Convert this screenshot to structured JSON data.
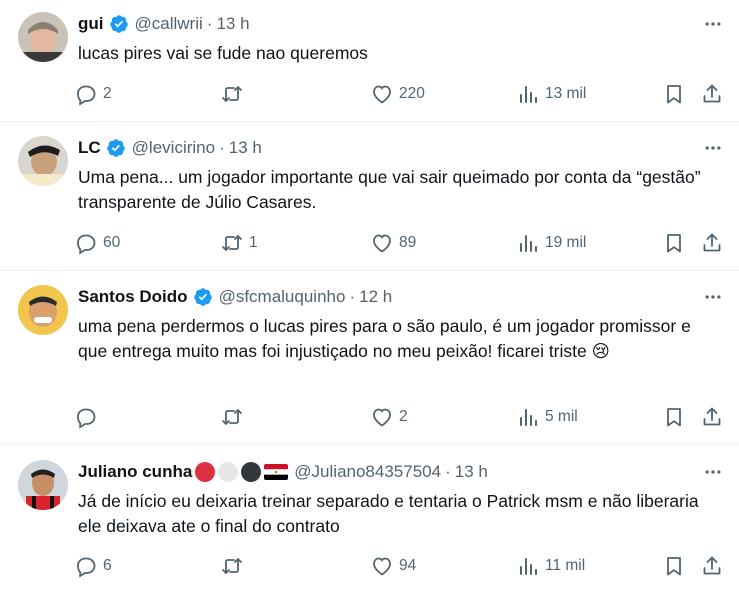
{
  "tweets": [
    {
      "name": "gui",
      "handle": "@callwrii",
      "time": "13 h",
      "text": "lucas pires vai se fude nao queremos",
      "replies": "2",
      "retweets": "",
      "likes": "220",
      "views": "13 mil"
    },
    {
      "name": "LC",
      "handle": "@levicirino",
      "time": "13 h",
      "text": "Uma pena... um jogador importante que vai sair queimado por conta da “gestão” transparente de Júlio Casares.",
      "replies": "60",
      "retweets": "1",
      "likes": "89",
      "views": "19 mil"
    },
    {
      "name": "Santos Doido",
      "handle": "@sfcmaluquinho",
      "time": "12 h",
      "text": "uma pena perdermos o lucas pires para o são paulo, é um jogador promissor e que entrega muito mas foi injustiçado no meu peixão! ficarei triste 😢",
      "replies": "",
      "retweets": "",
      "likes": "2",
      "views": "5 mil"
    },
    {
      "name": "Juliano cunha",
      "handle": "@Juliano84357504",
      "time": "13 h",
      "text": "Já de início eu deixaria treinar separado e tentaria o Patrick msm e não liberaria ele deixava ate o final do contrato",
      "replies": "6",
      "retweets": "",
      "likes": "94",
      "views": "11 mil"
    }
  ],
  "colors": {
    "verified": "#1d9bf0",
    "icon_gray": "#536471",
    "text": "#0f1419",
    "divider": "#eff3f4"
  }
}
